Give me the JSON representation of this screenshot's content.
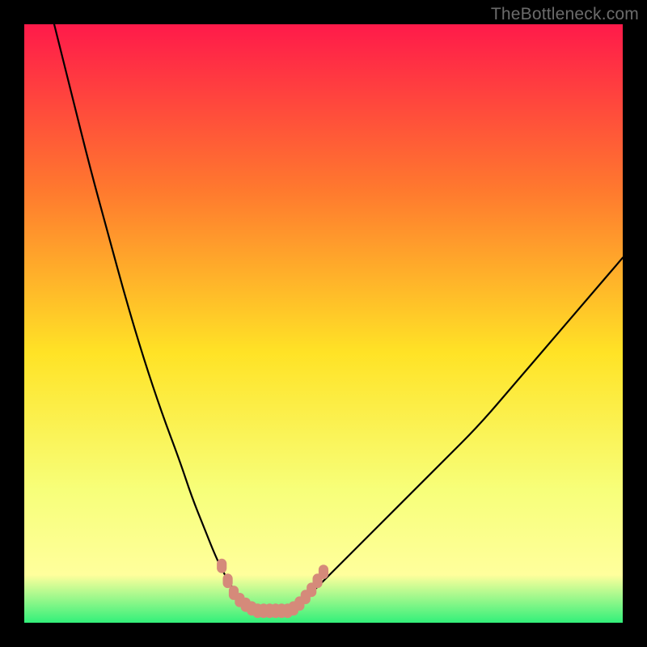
{
  "watermark": {
    "text": "TheBottleneck.com"
  },
  "colors": {
    "background": "#000000",
    "gradient_top": "#ff1a4a",
    "gradient_mid_upper": "#ff7a2e",
    "gradient_mid": "#ffe326",
    "gradient_lower": "#f7ff7a",
    "gradient_base_yellow": "#ffff9c",
    "gradient_base_green": "#32f07a",
    "curve_stroke": "#000000",
    "marker_fill": "#d58a7a",
    "marker_stroke": "#d58a7a"
  },
  "chart_data": {
    "type": "line",
    "title": "",
    "xlabel": "",
    "ylabel": "",
    "xlim": [
      0,
      100
    ],
    "ylim": [
      0,
      100
    ],
    "grid": false,
    "legend": false,
    "series": [
      {
        "name": "curve-left",
        "x": [
          5,
          8,
          11,
          14,
          17,
          20,
          23,
          26,
          28,
          30,
          32,
          33.5,
          35,
          36,
          37,
          38,
          39
        ],
        "y": [
          100,
          88,
          76,
          65,
          54,
          44,
          35,
          27,
          21,
          16,
          11,
          8,
          5.5,
          4,
          3,
          2.3,
          2
        ]
      },
      {
        "name": "curve-right",
        "x": [
          44,
          45,
          46,
          47,
          49,
          52,
          56,
          60,
          65,
          70,
          76,
          82,
          88,
          94,
          100
        ],
        "y": [
          2,
          2.3,
          3,
          4,
          6,
          9,
          13,
          17,
          22,
          27,
          33,
          40,
          47,
          54,
          61
        ]
      },
      {
        "name": "flat-bottom",
        "x": [
          39,
          40,
          41,
          42,
          43,
          44
        ],
        "y": [
          2,
          2,
          2,
          2,
          2,
          2
        ]
      }
    ],
    "markers": [
      {
        "x": 33.0,
        "y": 9.5
      },
      {
        "x": 34.0,
        "y": 7.0
      },
      {
        "x": 35.0,
        "y": 5.0
      },
      {
        "x": 36.0,
        "y": 3.8
      },
      {
        "x": 37.0,
        "y": 3.0
      },
      {
        "x": 38.0,
        "y": 2.4
      },
      {
        "x": 39.0,
        "y": 2.0
      },
      {
        "x": 40.0,
        "y": 2.0
      },
      {
        "x": 41.0,
        "y": 2.0
      },
      {
        "x": 42.0,
        "y": 2.0
      },
      {
        "x": 43.0,
        "y": 2.0
      },
      {
        "x": 44.0,
        "y": 2.0
      },
      {
        "x": 45.0,
        "y": 2.4
      },
      {
        "x": 46.0,
        "y": 3.2
      },
      {
        "x": 47.0,
        "y": 4.3
      },
      {
        "x": 48.0,
        "y": 5.5
      },
      {
        "x": 49.0,
        "y": 7.0
      },
      {
        "x": 50.0,
        "y": 8.5
      }
    ],
    "marker_radius_px": 7
  }
}
